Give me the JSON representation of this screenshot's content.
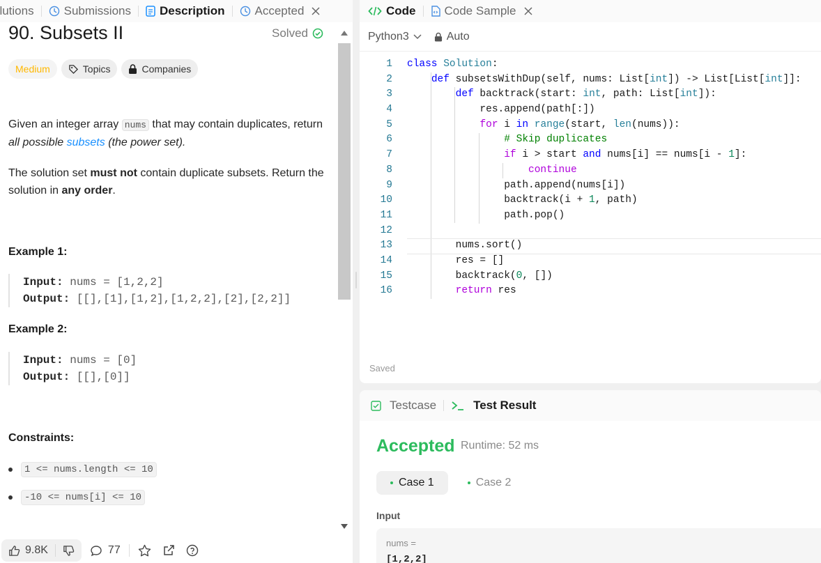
{
  "left_tabs": [
    {
      "label": "olutions"
    },
    {
      "label": "Submissions"
    },
    {
      "label": "Description"
    },
    {
      "label": "Accepted"
    }
  ],
  "problem": {
    "title": "90. Subsets II",
    "solved_label": "Solved",
    "difficulty": "Medium",
    "topics_label": "Topics",
    "companies_label": "Companies",
    "desc1_pre": "Given an integer array ",
    "desc1_code": "nums",
    "desc1_mid": " that may contain duplicates, return ",
    "desc1_em": "all possible ",
    "desc1_link": "subsets",
    "desc1_post": " (the power set).",
    "desc2_pre": "The solution set ",
    "desc2_bold1": "must not",
    "desc2_mid": " contain duplicate subsets. Return the solution in ",
    "desc2_bold2": "any order",
    "desc2_post": ".",
    "examples": [
      {
        "title": "Example 1:",
        "input_label": "Input:",
        "input": " nums = [1,2,2]",
        "output_label": "Output:",
        "output": " [[],[1],[1,2],[1,2,2],[2],[2,2]]"
      },
      {
        "title": "Example 2:",
        "input_label": "Input:",
        "input": " nums = [0]",
        "output_label": "Output:",
        "output": " [[],[0]]"
      }
    ],
    "constraints_title": "Constraints:",
    "constraints": [
      "1 <= nums.length <= 10",
      "-10 <= nums[i] <= 10"
    ]
  },
  "footer": {
    "likes": "9.8K",
    "comments": "77"
  },
  "code_tabs": [
    {
      "label": "Code"
    },
    {
      "label": "Code Sample"
    }
  ],
  "toolbar": {
    "language": "Python3",
    "mode": "Auto"
  },
  "code_lines": [
    "class Solution:",
    "    def subsetsWithDup(self, nums: List[int]) -> List[List[int]]:",
    "        def backtrack(start: int, path: List[int]):",
    "            res.append(path[:])",
    "            for i in range(start, len(nums)):",
    "                # Skip duplicates",
    "                if i > start and nums[i] == nums[i - 1]:",
    "                    continue",
    "                path.append(nums[i])",
    "                backtrack(i + 1, path)",
    "                path.pop()",
    "",
    "        nums.sort()",
    "        res = []",
    "        backtrack(0, [])",
    "        return res"
  ],
  "editor": {
    "saved_label": "Saved"
  },
  "test": {
    "tab_testcase": "Testcase",
    "tab_result": "Test Result",
    "status": "Accepted",
    "runtime": "Runtime: 52 ms",
    "cases": [
      "Case 1",
      "Case 2"
    ],
    "input_label": "Input",
    "var_name": "nums =",
    "var_value": "[1,2,2]"
  },
  "colors": {
    "accent_green": "#2cbb5d",
    "medium": "#ffb800",
    "link": "#1a90ff"
  }
}
